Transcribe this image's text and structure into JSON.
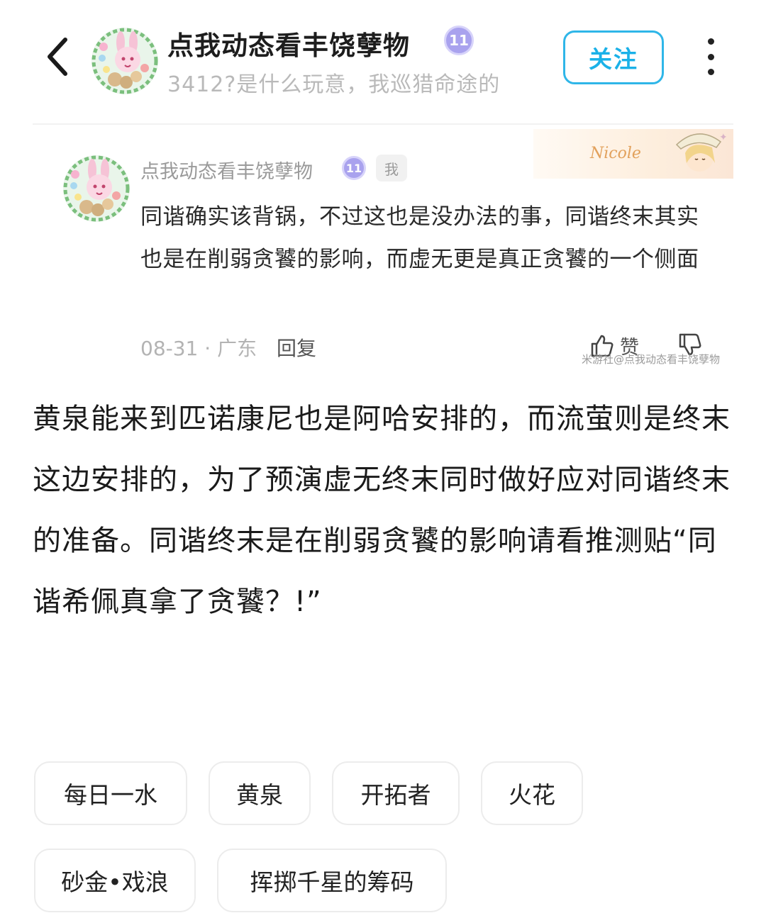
{
  "header": {
    "author_name": "点我动态看丰饶孽物",
    "level": "11",
    "signature": "3412?是什么玩意，我巡猎命途的",
    "follow_label": "关注"
  },
  "comment": {
    "author_name": "点我动态看丰饶孽物",
    "level": "11",
    "me_badge": "我",
    "decoration_text": "Nicole",
    "body": "同谐确实该背锅，不过这也是没办法的事，同谐终末其实也是在削弱贪饕的影响，而虚无更是真正贪饕的一个侧面",
    "date": "08-31",
    "separator": "·",
    "location": "广东",
    "reply_label": "回复",
    "like_label": "赞",
    "watermark": "米游社@点我动态看丰饶孽物"
  },
  "post": {
    "body": "黄泉能来到匹诺康尼也是阿哈安排的，而流萤则是终末这边安排的，为了预演虚无终末同时做好应对同谐终末的准备。同谐终末是在削弱贪饕的影响请看推测贴“同谐希佩真拿了贪饕？!”"
  },
  "tags": [
    "每日一水",
    "黄泉",
    "开拓者",
    "火花",
    "砂金•戏浪",
    "挥掷千星的筹码"
  ],
  "colors": {
    "accent": "#1ab1e8",
    "level_badge": "#a9a2ee",
    "muted_text": "#b9b9b9"
  }
}
